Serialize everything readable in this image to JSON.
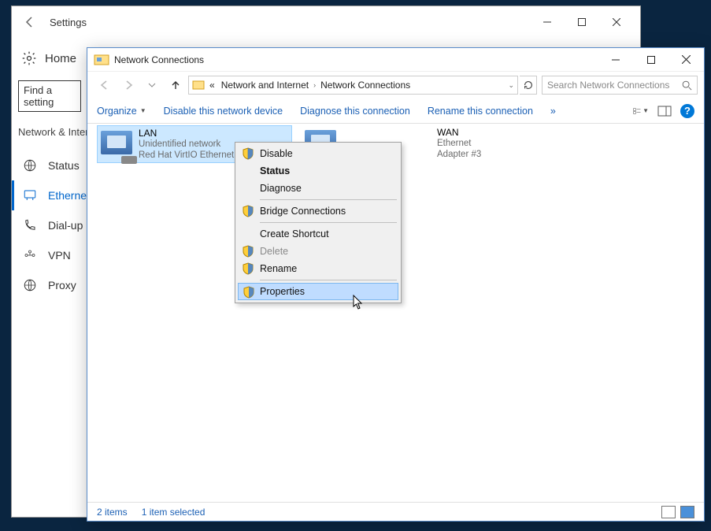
{
  "settings": {
    "title": "Settings",
    "home": "Home",
    "find_placeholder": "Find a setting",
    "section": "Network & Internet",
    "items": [
      {
        "label": "Status"
      },
      {
        "label": "Ethernet"
      },
      {
        "label": "Dial-up"
      },
      {
        "label": "VPN"
      },
      {
        "label": "Proxy"
      }
    ]
  },
  "explorer": {
    "title": "Network Connections",
    "breadcrumb": {
      "prefix": "«",
      "parent": "Network and Internet",
      "current": "Network Connections"
    },
    "search_placeholder": "Search Network Connections",
    "toolbar": {
      "organize": "Organize",
      "disable": "Disable this network device",
      "diagnose": "Diagnose this connection",
      "rename": "Rename this connection"
    },
    "adapters": {
      "lan": {
        "name": "LAN",
        "line2": "Unidentified network",
        "line3": "Red Hat VirtIO Ethernet"
      },
      "wan": {
        "name": "WAN",
        "line2": "",
        "line3": "Ethernet Adapter #3"
      }
    },
    "context_menu": {
      "disable": "Disable",
      "status": "Status",
      "diagnose": "Diagnose",
      "bridge": "Bridge Connections",
      "shortcut": "Create Shortcut",
      "delete": "Delete",
      "rename": "Rename",
      "properties": "Properties"
    },
    "statusbar": {
      "count": "2 items",
      "selected": "1 item selected"
    }
  }
}
